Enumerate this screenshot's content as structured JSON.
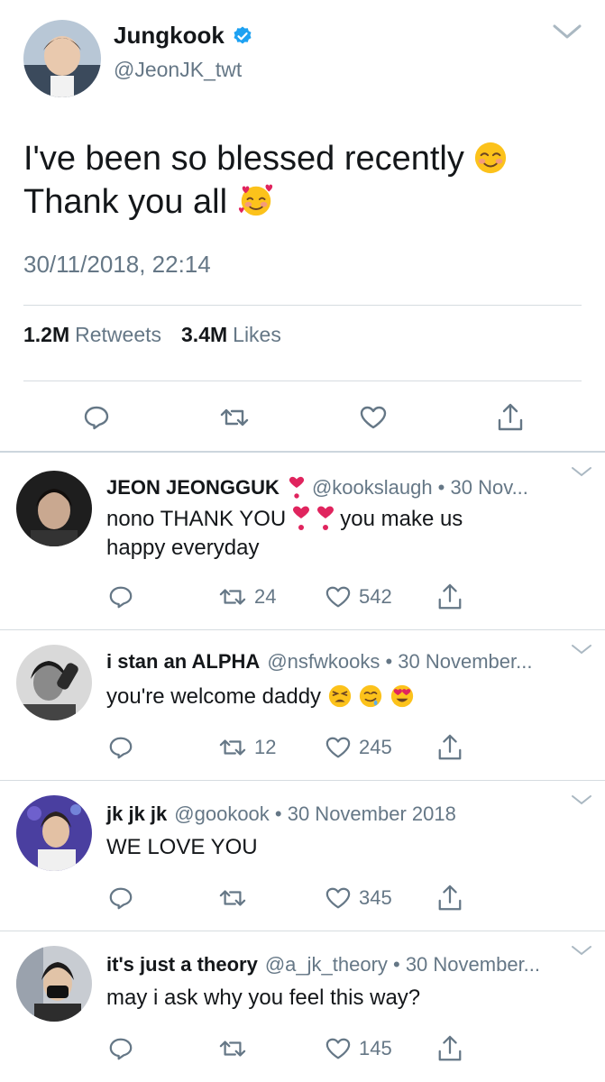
{
  "main_tweet": {
    "author_name": "Jungkook",
    "author_handle": "@JeonJK_twt",
    "text_line1": "I've been so blessed recently",
    "text_line2": "Thank you all",
    "timestamp": "30/11/2018, 22:14",
    "retweet_count": "1.2M",
    "retweet_label": "Retweets",
    "like_count": "3.4M",
    "like_label": "Likes"
  },
  "replies": [
    {
      "name": "JEON JEONGGUK",
      "meta": "@kookslaugh • 30 Nov...",
      "text_before": "nono THANK YOU",
      "text_after": "you make us",
      "text_line2": "happy everyday",
      "retweets": "24",
      "likes": "542"
    },
    {
      "name": "i stan an ALPHA",
      "meta": "@nsfwkooks • 30 November...",
      "text": "you're welcome daddy",
      "retweets": "12",
      "likes": "245"
    },
    {
      "name": "jk jk jk",
      "meta": "@gookook • 30 November 2018",
      "text": "WE LOVE YOU",
      "retweets": "",
      "likes": "345"
    },
    {
      "name": "it's just a theory",
      "meta": "@a_jk_theory • 30 November...",
      "text": "may i ask why you feel this way?",
      "retweets": "",
      "likes": "145"
    }
  ],
  "colors": {
    "text_primary": "#14171a",
    "text_secondary": "#657786",
    "divider": "#d6dce0",
    "verified_blue": "#1da1f2"
  },
  "icons": [
    "reply-icon",
    "retweet-icon",
    "like-icon",
    "share-icon",
    "chevron-down-icon",
    "verified-badge-icon"
  ]
}
